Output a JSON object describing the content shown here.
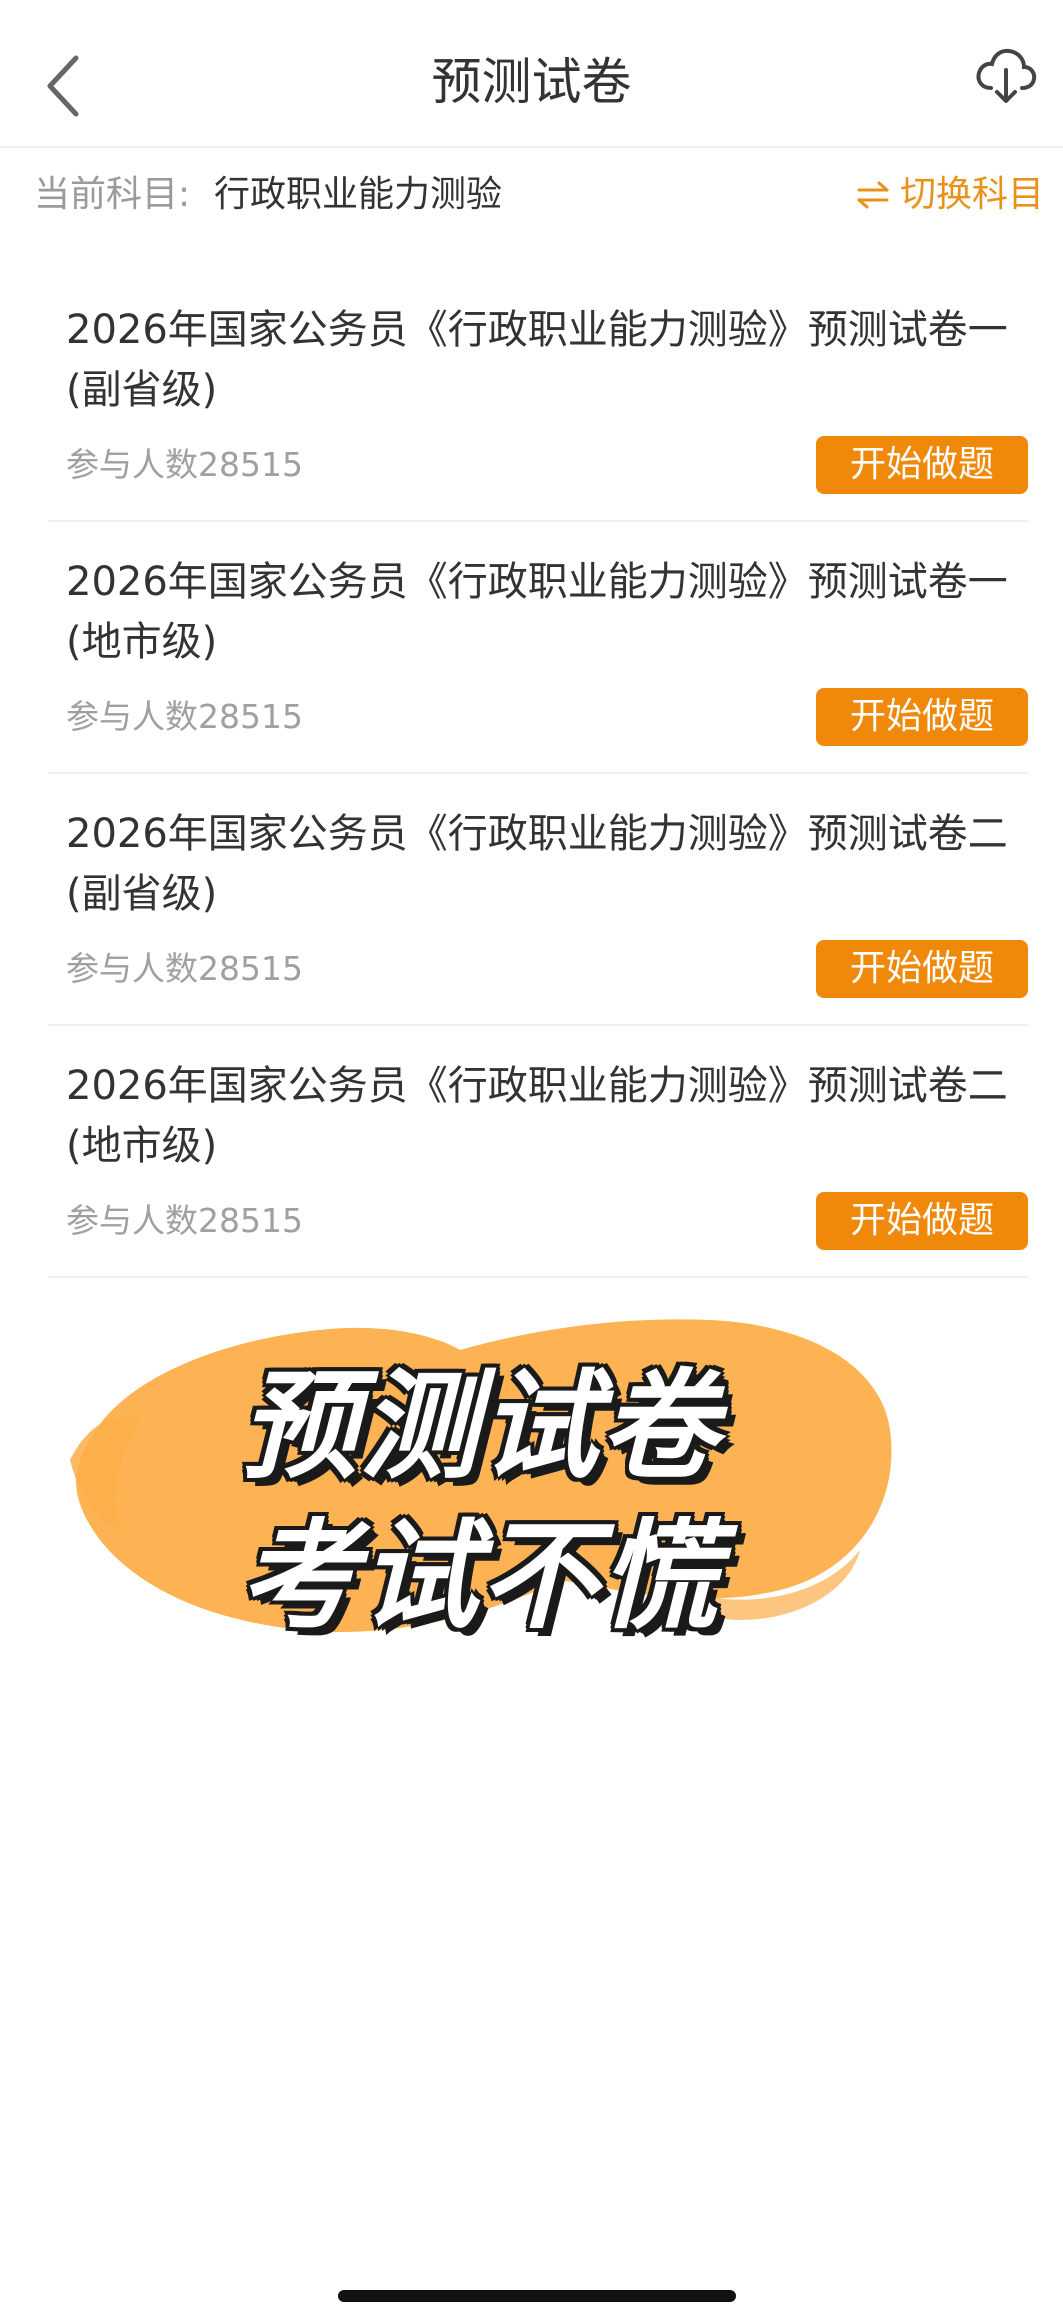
{
  "header": {
    "title": "预测试卷",
    "back_icon": "chevron-left-icon",
    "download_icon": "cloud-download-icon"
  },
  "subject_bar": {
    "label": "当前科目:",
    "value": "行政职业能力测验",
    "switch_label": "切换科目",
    "switch_icon": "swap-arrows-icon"
  },
  "papers": [
    {
      "title": "2026年国家公务员《行政职业能力测验》预测试卷一(副省级)",
      "participants": "参与人数28515",
      "button_label": "开始做题"
    },
    {
      "title": "2026年国家公务员《行政职业能力测验》预测试卷一(地市级)",
      "participants": "参与人数28515",
      "button_label": "开始做题"
    },
    {
      "title": "2026年国家公务员《行政职业能力测验》预测试卷二(副省级)",
      "participants": "参与人数28515",
      "button_label": "开始做题"
    },
    {
      "title": "2026年国家公务员《行政职业能力测验》预测试卷二(地市级)",
      "participants": "参与人数28515",
      "button_label": "开始做题"
    }
  ],
  "promo": {
    "line1": "预测试卷",
    "line2": "考试不慌"
  },
  "colors": {
    "accent": "#f0880a",
    "switch_text": "#e8921c",
    "promo_blob": "#fdae4a"
  }
}
